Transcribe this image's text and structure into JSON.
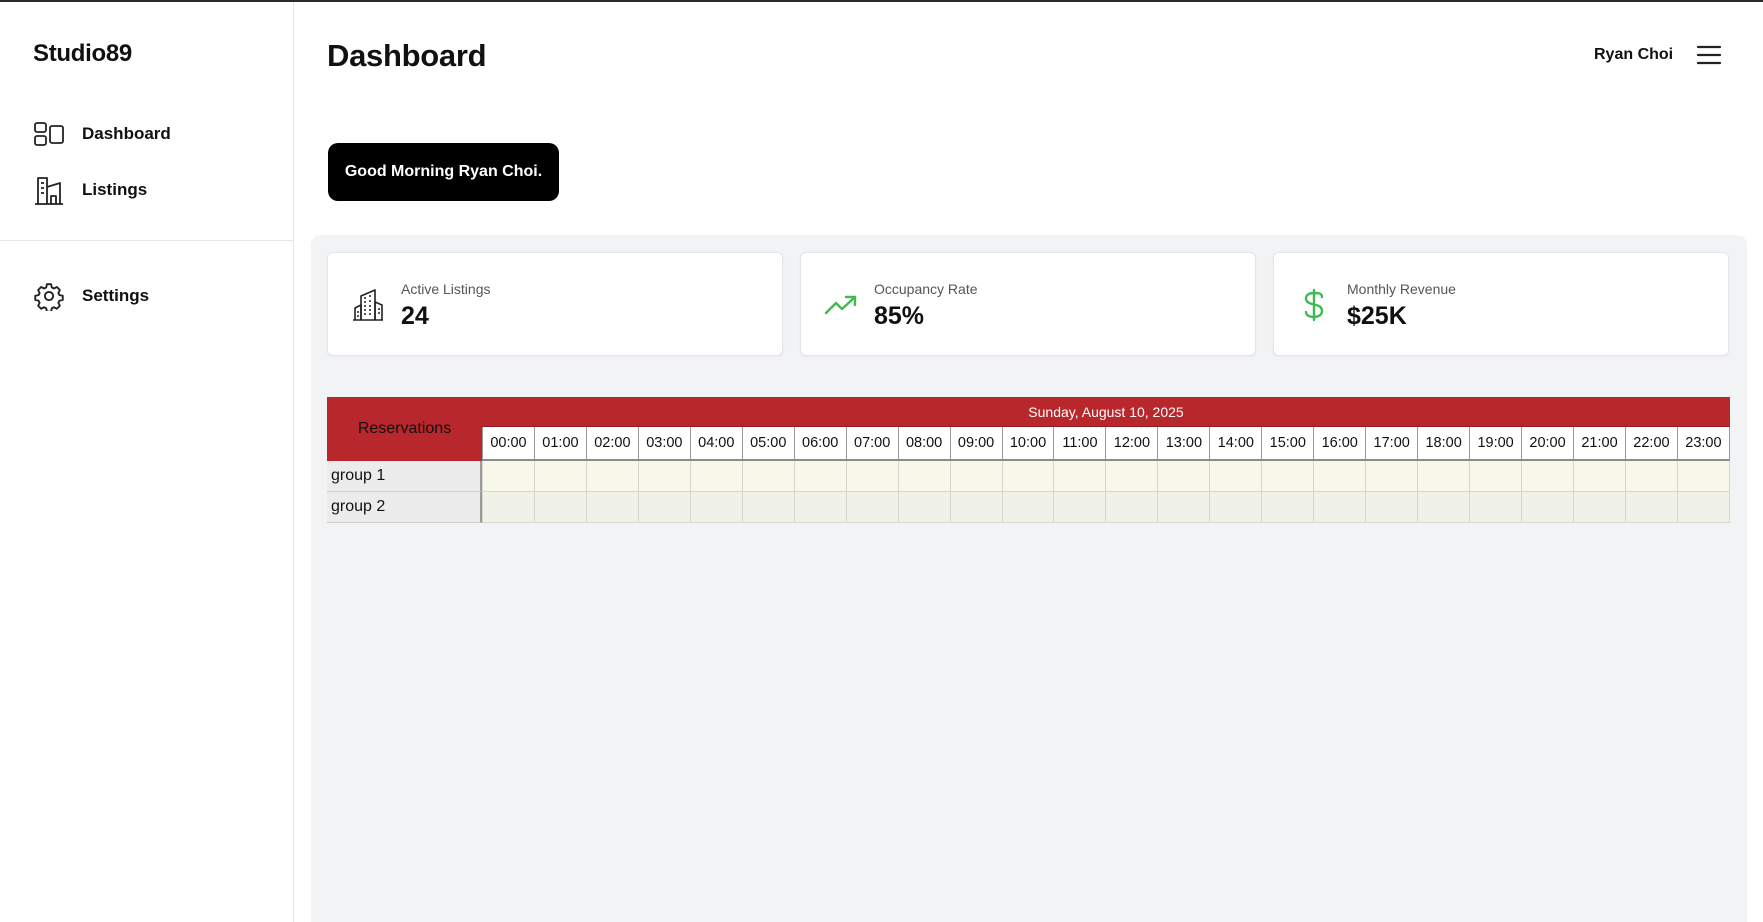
{
  "app": {
    "brand": "Studio89"
  },
  "sidebar": {
    "items": [
      {
        "label": "Dashboard",
        "icon": "dashboard-icon"
      },
      {
        "label": "Listings",
        "icon": "building-icon"
      },
      {
        "label": "Settings",
        "icon": "gear-icon"
      }
    ]
  },
  "header": {
    "title": "Dashboard",
    "user": "Ryan Choi",
    "menu_icon": "hamburger-menu-icon"
  },
  "greeting": "Good Morning Ryan Choi.",
  "stats": [
    {
      "label": "Active Listings",
      "value": "24",
      "icon": "office-building-icon"
    },
    {
      "label": "Occupancy Rate",
      "value": "85%",
      "icon": "trending-up-icon",
      "color": "#3fb950"
    },
    {
      "label": "Monthly Revenue",
      "value": "$25K",
      "icon": "dollar-icon",
      "color": "#3fb950"
    }
  ],
  "schedule": {
    "header_label": "Reservations",
    "date": "Sunday, August 10, 2025",
    "header_color": "#b8272b",
    "hours": [
      "00:00",
      "01:00",
      "02:00",
      "03:00",
      "04:00",
      "05:00",
      "06:00",
      "07:00",
      "08:00",
      "09:00",
      "10:00",
      "11:00",
      "12:00",
      "13:00",
      "14:00",
      "15:00",
      "16:00",
      "17:00",
      "18:00",
      "19:00",
      "20:00",
      "21:00",
      "22:00",
      "23:00"
    ],
    "groups": [
      "group 1",
      "group 2"
    ]
  }
}
